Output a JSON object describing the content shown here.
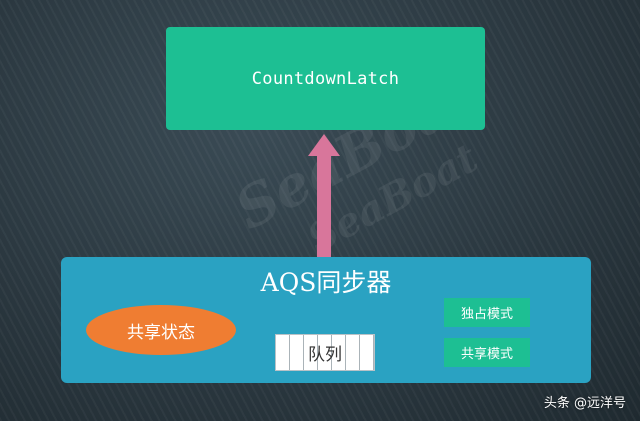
{
  "top_box": {
    "label": "CountdownLatch",
    "color": "#1dbf93"
  },
  "arrow": {
    "color": "#d8769b",
    "direction": "up"
  },
  "aqs": {
    "title": "AQS同步器",
    "color": "#2aa2c2",
    "shared_state": {
      "label": "共享状态",
      "color": "#ef7d32"
    },
    "queue": {
      "label": "队列",
      "cells": 7
    },
    "modes": [
      {
        "label": "独占模式"
      },
      {
        "label": "共享模式"
      }
    ]
  },
  "watermark": {
    "text": "SeaBoat"
  },
  "attribution": "头条 @远洋号"
}
